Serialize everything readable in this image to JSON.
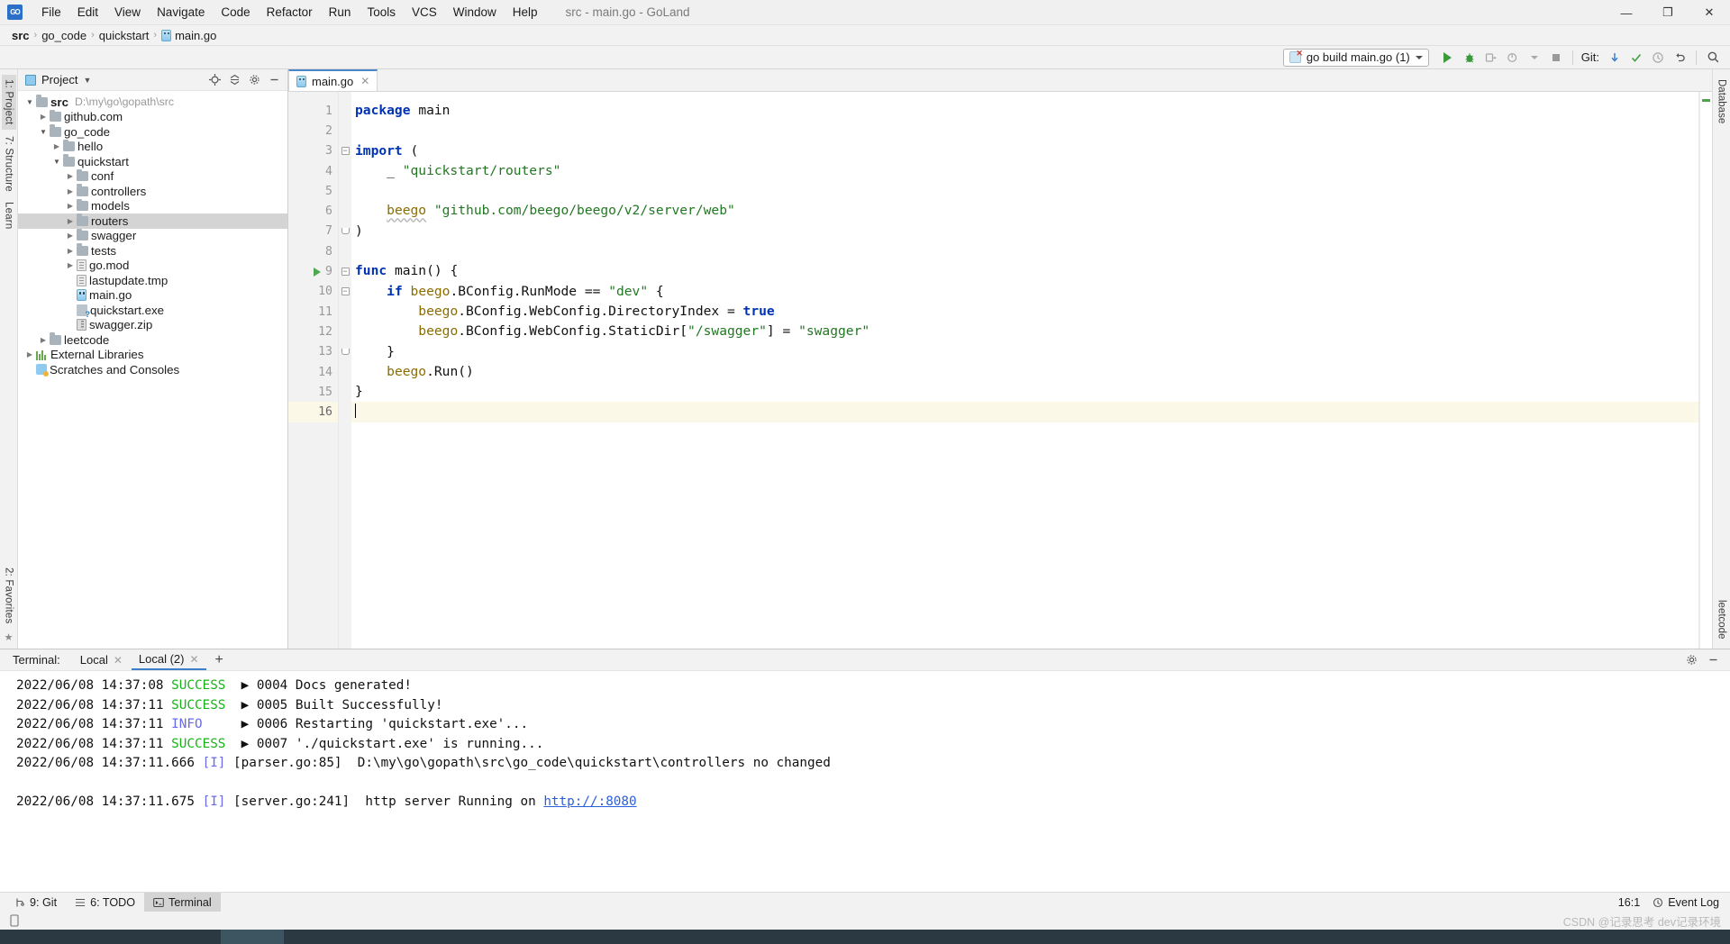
{
  "titlebar": {
    "logo": "GO",
    "window_title": "src - main.go - GoLand",
    "menus": [
      {
        "label": "File",
        "mnemonic": "F"
      },
      {
        "label": "Edit",
        "mnemonic": "E"
      },
      {
        "label": "View",
        "mnemonic": "V"
      },
      {
        "label": "Navigate",
        "mnemonic": "N"
      },
      {
        "label": "Code",
        "mnemonic": "C"
      },
      {
        "label": "Refactor",
        "mnemonic": "R"
      },
      {
        "label": "Run",
        "mnemonic": "u"
      },
      {
        "label": "Tools",
        "mnemonic": "T"
      },
      {
        "label": "VCS",
        "mnemonic": "S"
      },
      {
        "label": "Window",
        "mnemonic": "W"
      },
      {
        "label": "Help",
        "mnemonic": "H"
      }
    ],
    "window_controls": {
      "minimize": "—",
      "maximize": "❐",
      "close": "✕"
    }
  },
  "breadcrumb": {
    "items": [
      "src",
      "go_code",
      "quickstart",
      "main.go"
    ],
    "separator": "›"
  },
  "toolbar": {
    "run_config": "go build main.go (1)",
    "run_config_caret": "▼",
    "git_label": "Git:",
    "icons": [
      "run-icon",
      "debug-icon",
      "run-coverage-icon",
      "profile-icon",
      "stop-icon",
      "git-update-icon",
      "git-commit-icon",
      "git-history-icon",
      "git-rollback-icon",
      "search-everywhere-icon"
    ]
  },
  "left_strip": {
    "tabs": [
      "1: Project",
      "7: Structure",
      "Learn"
    ],
    "bottom": [
      "2: Favorites"
    ]
  },
  "right_strip": {
    "tabs": [
      "Database",
      "leetcode"
    ]
  },
  "project_panel": {
    "title": "Project",
    "title_caret": "▼",
    "actions": [
      "locate-icon",
      "collapse-all-icon",
      "settings-icon",
      "hide-icon"
    ],
    "tree": [
      {
        "depth": 0,
        "arrow": "open",
        "icon": "folder",
        "label": "src",
        "bold": true,
        "path": "D:\\my\\go\\gopath\\src",
        "selected": false
      },
      {
        "depth": 1,
        "arrow": "closed",
        "icon": "folder",
        "label": "github.com",
        "selected": false
      },
      {
        "depth": 1,
        "arrow": "open",
        "icon": "folder",
        "label": "go_code",
        "selected": false
      },
      {
        "depth": 2,
        "arrow": "closed",
        "icon": "folder",
        "label": "hello",
        "selected": false
      },
      {
        "depth": 2,
        "arrow": "open",
        "icon": "folder",
        "label": "quickstart",
        "selected": false
      },
      {
        "depth": 3,
        "arrow": "closed",
        "icon": "folder",
        "label": "conf",
        "selected": false
      },
      {
        "depth": 3,
        "arrow": "closed",
        "icon": "folder",
        "label": "controllers",
        "selected": false
      },
      {
        "depth": 3,
        "arrow": "closed",
        "icon": "folder",
        "label": "models",
        "selected": false
      },
      {
        "depth": 3,
        "arrow": "closed",
        "icon": "folder",
        "label": "routers",
        "selected": true
      },
      {
        "depth": 3,
        "arrow": "closed",
        "icon": "folder",
        "label": "swagger",
        "selected": false
      },
      {
        "depth": 3,
        "arrow": "closed",
        "icon": "folder",
        "label": "tests",
        "selected": false
      },
      {
        "depth": 3,
        "arrow": "closed",
        "icon": "file",
        "label": "go.mod",
        "selected": false
      },
      {
        "depth": 3,
        "arrow": "none",
        "icon": "file",
        "label": "lastupdate.tmp",
        "selected": false
      },
      {
        "depth": 3,
        "arrow": "none",
        "icon": "go",
        "label": "main.go",
        "selected": false
      },
      {
        "depth": 3,
        "arrow": "none",
        "icon": "exe",
        "label": "quickstart.exe",
        "selected": false
      },
      {
        "depth": 3,
        "arrow": "none",
        "icon": "zip",
        "label": "swagger.zip",
        "selected": false
      },
      {
        "depth": 1,
        "arrow": "closed",
        "icon": "folder",
        "label": "leetcode",
        "selected": false
      },
      {
        "depth": 0,
        "arrow": "closed",
        "icon": "lib",
        "label": "External Libraries",
        "selected": false
      },
      {
        "depth": 0,
        "arrow": "none",
        "icon": "scratch",
        "label": "Scratches and Consoles",
        "selected": false
      }
    ]
  },
  "editor": {
    "tabs": [
      {
        "label": "main.go",
        "icon": "go-file-icon",
        "active": true,
        "close": "✕"
      }
    ],
    "lines": [
      {
        "n": 1,
        "fold": "none",
        "run": false,
        "current": false,
        "tokens": [
          {
            "t": "package",
            "c": "k"
          },
          {
            "t": " ",
            "c": "plain"
          },
          {
            "t": "main",
            "c": "plain"
          }
        ]
      },
      {
        "n": 2,
        "fold": "none",
        "run": false,
        "current": false,
        "tokens": []
      },
      {
        "n": 3,
        "fold": "open",
        "run": false,
        "current": false,
        "tokens": [
          {
            "t": "import",
            "c": "k"
          },
          {
            "t": " (",
            "c": "plain"
          }
        ]
      },
      {
        "n": 4,
        "fold": "none",
        "run": false,
        "current": false,
        "tokens": [
          {
            "t": "\t_ ",
            "c": "plain"
          },
          {
            "t": "\"quickstart/routers\"",
            "c": "s"
          }
        ]
      },
      {
        "n": 5,
        "fold": "none",
        "run": false,
        "current": false,
        "tokens": []
      },
      {
        "n": 6,
        "fold": "none",
        "run": false,
        "current": false,
        "tokens": [
          {
            "t": "\t",
            "c": "plain"
          },
          {
            "t": "beego",
            "c": "id underlined"
          },
          {
            "t": " ",
            "c": "plain"
          },
          {
            "t": "\"github.com/beego/beego/v2/server/web\"",
            "c": "s"
          }
        ]
      },
      {
        "n": 7,
        "fold": "close",
        "run": false,
        "current": false,
        "tokens": [
          {
            "t": ")",
            "c": "plain"
          }
        ]
      },
      {
        "n": 8,
        "fold": "none",
        "run": false,
        "current": false,
        "tokens": []
      },
      {
        "n": 9,
        "fold": "open",
        "run": true,
        "current": false,
        "tokens": [
          {
            "t": "func",
            "c": "k"
          },
          {
            "t": " ",
            "c": "plain"
          },
          {
            "t": "main",
            "c": "plain"
          },
          {
            "t": "() {",
            "c": "plain"
          }
        ]
      },
      {
        "n": 10,
        "fold": "open",
        "run": false,
        "current": false,
        "tokens": [
          {
            "t": "\t",
            "c": "plain"
          },
          {
            "t": "if",
            "c": "k"
          },
          {
            "t": " ",
            "c": "plain"
          },
          {
            "t": "beego",
            "c": "id"
          },
          {
            "t": ".BConfig.RunMode == ",
            "c": "plain"
          },
          {
            "t": "\"dev\"",
            "c": "s"
          },
          {
            "t": " {",
            "c": "plain"
          }
        ]
      },
      {
        "n": 11,
        "fold": "none",
        "run": false,
        "current": false,
        "tokens": [
          {
            "t": "\t\t",
            "c": "plain"
          },
          {
            "t": "beego",
            "c": "id"
          },
          {
            "t": ".BConfig.WebConfig.DirectoryIndex = ",
            "c": "plain"
          },
          {
            "t": "true",
            "c": "k"
          }
        ]
      },
      {
        "n": 12,
        "fold": "none",
        "run": false,
        "current": false,
        "tokens": [
          {
            "t": "\t\t",
            "c": "plain"
          },
          {
            "t": "beego",
            "c": "id"
          },
          {
            "t": ".BConfig.WebConfig.StaticDir[",
            "c": "plain"
          },
          {
            "t": "\"/swagger\"",
            "c": "s"
          },
          {
            "t": "] = ",
            "c": "plain"
          },
          {
            "t": "\"swagger\"",
            "c": "s"
          }
        ]
      },
      {
        "n": 13,
        "fold": "close",
        "run": false,
        "current": false,
        "tokens": [
          {
            "t": "\t}",
            "c": "plain"
          }
        ]
      },
      {
        "n": 14,
        "fold": "none",
        "run": false,
        "current": false,
        "tokens": [
          {
            "t": "\t",
            "c": "plain"
          },
          {
            "t": "beego",
            "c": "id"
          },
          {
            "t": ".Run()",
            "c": "plain"
          }
        ]
      },
      {
        "n": 15,
        "fold": "none",
        "run": false,
        "current": false,
        "tokens": [
          {
            "t": "}",
            "c": "plain"
          }
        ]
      },
      {
        "n": 16,
        "fold": "none",
        "run": false,
        "current": true,
        "tokens": []
      }
    ]
  },
  "terminal": {
    "label": "Terminal:",
    "tabs": [
      {
        "label": "Local",
        "active": false,
        "close": "✕"
      },
      {
        "label": "Local (2)",
        "active": true,
        "close": "✕"
      }
    ],
    "add": "+",
    "actions": [
      "settings-icon",
      "hide-icon"
    ],
    "lines": [
      {
        "segments": [
          {
            "t": "2022/06/08 14:37:08 ",
            "c": "plain"
          },
          {
            "t": "SUCCESS",
            "c": "t-succ"
          },
          {
            "t": "  ▶ 0004 Docs generated!",
            "c": "plain"
          }
        ]
      },
      {
        "segments": [
          {
            "t": "2022/06/08 14:37:11 ",
            "c": "plain"
          },
          {
            "t": "SUCCESS",
            "c": "t-succ"
          },
          {
            "t": "  ▶ 0005 Built Successfully!",
            "c": "plain"
          }
        ]
      },
      {
        "segments": [
          {
            "t": "2022/06/08 14:37:11 ",
            "c": "plain"
          },
          {
            "t": "INFO",
            "c": "t-info"
          },
          {
            "t": "     ▶ 0006 Restarting 'quickstart.exe'...",
            "c": "plain"
          }
        ]
      },
      {
        "segments": [
          {
            "t": "2022/06/08 14:37:11 ",
            "c": "plain"
          },
          {
            "t": "SUCCESS",
            "c": "t-succ"
          },
          {
            "t": "  ▶ 0007 './quickstart.exe' is running...",
            "c": "plain"
          }
        ]
      },
      {
        "segments": [
          {
            "t": "2022/06/08 14:37:11.666 ",
            "c": "plain"
          },
          {
            "t": "[I]",
            "c": "t-i"
          },
          {
            "t": " [parser.go:85]  D:\\my\\go\\gopath\\src\\go_code\\quickstart\\controllers no changed",
            "c": "plain"
          }
        ]
      },
      {
        "segments": []
      },
      {
        "segments": [
          {
            "t": "2022/06/08 14:37:11.675 ",
            "c": "plain"
          },
          {
            "t": "[I]",
            "c": "t-i"
          },
          {
            "t": " [server.go:241]  http server Running on ",
            "c": "plain"
          },
          {
            "t": "http://:8080",
            "c": "t-link"
          }
        ]
      }
    ]
  },
  "statusbar": {
    "tools": [
      {
        "label": "9: Git",
        "mnemonic": "9",
        "icon": "git-icon",
        "active": false
      },
      {
        "label": "6: TODO",
        "mnemonic": "6",
        "icon": "todo-icon",
        "active": false
      },
      {
        "label": "Terminal",
        "mnemonic": "",
        "icon": "terminal-icon",
        "active": true
      }
    ],
    "caret_position": "16:1",
    "encoding": "",
    "event_log": "Event Log",
    "watermark": "CSDN @记录思考 dev记录环境"
  }
}
